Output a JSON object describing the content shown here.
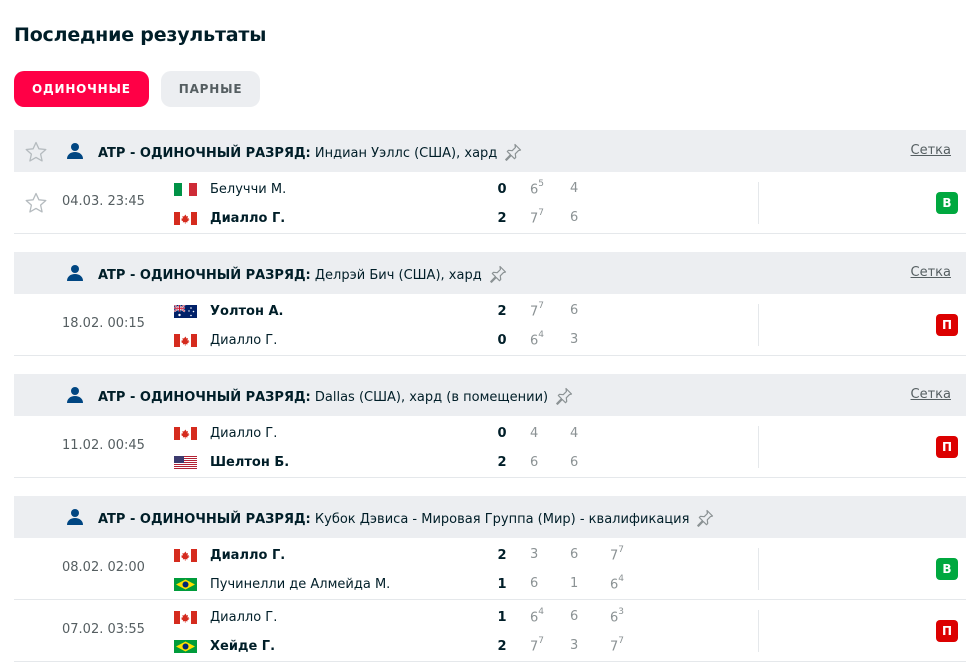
{
  "title": "Последние результаты",
  "tabs": [
    {
      "label": "ОДИНОЧНЫЕ",
      "active": true
    },
    {
      "label": "ПАРНЫЕ",
      "active": false
    }
  ],
  "colors": {
    "accent": "#ff0046",
    "win": "#00a83f",
    "loss": "#dc0000",
    "header_bg": "#eceef1"
  },
  "tournaments": [
    {
      "name_bold": "ATP - ОДИНОЧНЫЙ РАЗРЯД:",
      "name_rest": "Индиан Уэллс (США), хард",
      "link": "Сетка",
      "matches": [
        {
          "time": "04.03. 23:45",
          "p1": {
            "name": "Белуччи М.",
            "flag": "italy",
            "win": false,
            "total": "0",
            "sets": [
              [
                "6",
                "5"
              ],
              [
                "4",
                ""
              ]
            ]
          },
          "p2": {
            "name": "Диалло Г.",
            "flag": "canada",
            "win": true,
            "total": "2",
            "sets": [
              [
                "7",
                "7"
              ],
              [
                "6",
                ""
              ]
            ]
          },
          "result": "В"
        }
      ]
    },
    {
      "name_bold": "ATP - ОДИНОЧНЫЙ РАЗРЯД:",
      "name_rest": "Делрэй Бич (США), хард",
      "link": "Сетка",
      "matches": [
        {
          "time": "18.02. 00:15",
          "p1": {
            "name": "Уолтон А.",
            "flag": "australia",
            "win": true,
            "total": "2",
            "sets": [
              [
                "7",
                "7"
              ],
              [
                "6",
                ""
              ]
            ]
          },
          "p2": {
            "name": "Диалло Г.",
            "flag": "canada",
            "win": false,
            "total": "0",
            "sets": [
              [
                "6",
                "4"
              ],
              [
                "3",
                ""
              ]
            ]
          },
          "result": "П"
        }
      ]
    },
    {
      "name_bold": "ATP - ОДИНОЧНЫЙ РАЗРЯД:",
      "name_rest": "Dallas (США), хард (в помещении)",
      "link": "Сетка",
      "matches": [
        {
          "time": "11.02. 00:45",
          "p1": {
            "name": "Диалло Г.",
            "flag": "canada",
            "win": false,
            "total": "0",
            "sets": [
              [
                "4",
                ""
              ],
              [
                "4",
                ""
              ]
            ]
          },
          "p2": {
            "name": "Шелтон Б.",
            "flag": "usa",
            "win": true,
            "total": "2",
            "sets": [
              [
                "6",
                ""
              ],
              [
                "6",
                ""
              ]
            ]
          },
          "result": "П"
        }
      ]
    },
    {
      "name_bold": "ATP - ОДИНОЧНЫЙ РАЗРЯД:",
      "name_rest": "Кубок Дэвиса - Мировая Группа (Мир) - квалификация",
      "link": "",
      "matches": [
        {
          "time": "08.02. 02:00",
          "p1": {
            "name": "Диалло Г.",
            "flag": "canada",
            "win": true,
            "total": "2",
            "sets": [
              [
                "3",
                ""
              ],
              [
                "6",
                ""
              ],
              [
                "7",
                "7"
              ]
            ]
          },
          "p2": {
            "name": "Пучинелли де Алмейда М.",
            "flag": "brazil",
            "win": false,
            "total": "1",
            "sets": [
              [
                "6",
                ""
              ],
              [
                "1",
                ""
              ],
              [
                "6",
                "4"
              ]
            ]
          },
          "result": "В"
        },
        {
          "time": "07.02. 03:55",
          "p1": {
            "name": "Диалло Г.",
            "flag": "canada",
            "win": false,
            "total": "1",
            "sets": [
              [
                "6",
                "4"
              ],
              [
                "6",
                ""
              ],
              [
                "6",
                "3"
              ]
            ]
          },
          "p2": {
            "name": "Хейде Г.",
            "flag": "brazil",
            "win": true,
            "total": "2",
            "sets": [
              [
                "7",
                "7"
              ],
              [
                "3",
                ""
              ],
              [
                "7",
                "7"
              ]
            ]
          },
          "result": "П"
        }
      ]
    }
  ]
}
